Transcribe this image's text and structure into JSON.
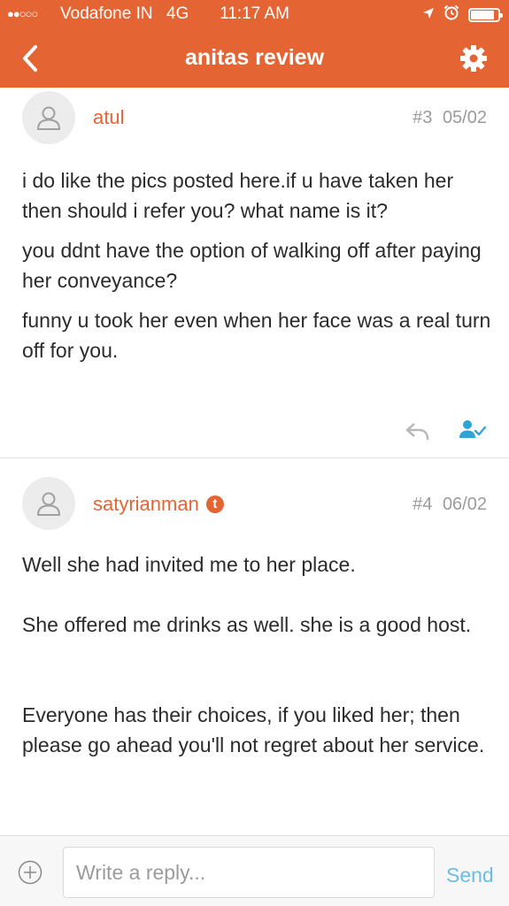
{
  "status_bar": {
    "signal": "●●○○○",
    "carrier": "Vodafone IN",
    "network": "4G",
    "time": "11:17 AM",
    "location_icon": "location-arrow-icon",
    "alarm_icon": "alarm-clock-icon",
    "battery_level": 0.85
  },
  "nav": {
    "title": "anitas review",
    "back_icon": "chevron-left-icon",
    "settings_icon": "gear-icon"
  },
  "posts": [
    {
      "username": "atul",
      "number": "#3",
      "date": "05/02",
      "paragraphs": [
        "i do like the pics posted here.if u have taken her then should i refer you? what name is it?",
        "you ddnt have the option of walking off after paying her conveyance?",
        "funny u took her even when her face was a real turn off for you."
      ]
    },
    {
      "username": "satyrianman",
      "badge": "t",
      "number": "#4",
      "date": "06/02",
      "paragraphs": [
        "Well she had invited me to her place.",
        "She offered me drinks as well. she is a good host.",
        "Everyone has their choices, if you liked her; then please go ahead you'll not regret about her service."
      ]
    }
  ],
  "reply_bar": {
    "placeholder": "Write a reply...",
    "value": "",
    "send_label": "Send"
  },
  "colors": {
    "brand": "#e56433",
    "send": "#6cbde6",
    "action_blue": "#2ea3d8",
    "meta_gray": "#9b9b9b"
  }
}
